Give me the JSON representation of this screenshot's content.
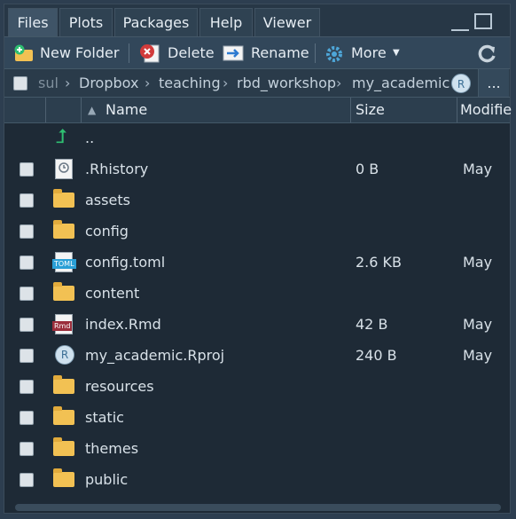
{
  "tabs": [
    "Files",
    "Plots",
    "Packages",
    "Help",
    "Viewer"
  ],
  "toolbar": {
    "new_folder": "New Folder",
    "delete": "Delete",
    "rename": "Rename",
    "more": "More"
  },
  "path": {
    "crumbs": [
      "sul",
      "Dropbox",
      "teaching",
      "rbd_workshop",
      "my_academic"
    ],
    "more": "..."
  },
  "columns": {
    "name": "Name",
    "size": "Size",
    "modified": "Modifie"
  },
  "files": [
    {
      "name": "..",
      "type": "up",
      "size": "",
      "modified": ""
    },
    {
      "name": ".Rhistory",
      "type": "history",
      "size": "0 B",
      "modified": "May"
    },
    {
      "name": "assets",
      "type": "folder",
      "size": "",
      "modified": ""
    },
    {
      "name": "config",
      "type": "folder",
      "size": "",
      "modified": ""
    },
    {
      "name": "config.toml",
      "type": "toml",
      "size": "2.6 KB",
      "modified": "May"
    },
    {
      "name": "content",
      "type": "folder",
      "size": "",
      "modified": ""
    },
    {
      "name": "index.Rmd",
      "type": "rmd",
      "size": "42 B",
      "modified": "May"
    },
    {
      "name": "my_academic.Rproj",
      "type": "rproj",
      "size": "240 B",
      "modified": "May"
    },
    {
      "name": "resources",
      "type": "folder",
      "size": "",
      "modified": ""
    },
    {
      "name": "static",
      "type": "folder",
      "size": "",
      "modified": ""
    },
    {
      "name": "themes",
      "type": "folder",
      "size": "",
      "modified": ""
    },
    {
      "name": "public",
      "type": "folder",
      "size": "",
      "modified": ""
    }
  ],
  "icons": {
    "toml_badge": "TOML",
    "rmd_badge": "Rmd",
    "rproj_badge": "R"
  }
}
